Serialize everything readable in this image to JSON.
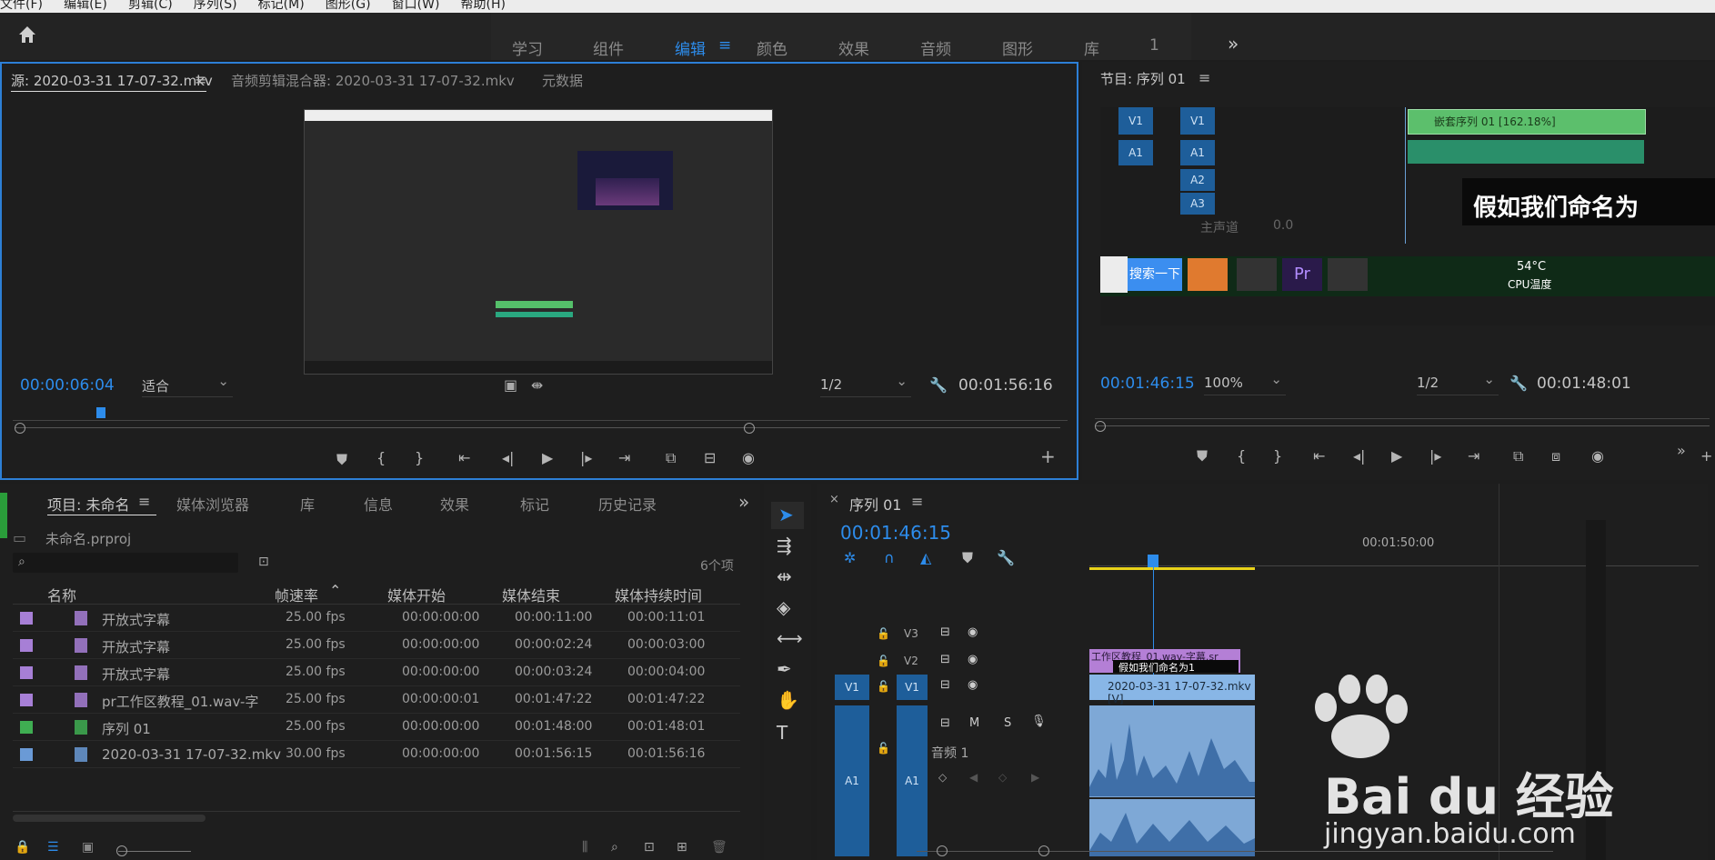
{
  "menu": [
    "文件(F)",
    "编辑(E)",
    "剪辑(C)",
    "序列(S)",
    "标记(M)",
    "图形(G)",
    "窗口(W)",
    "帮助(H)"
  ],
  "workspaces": [
    {
      "label": "学习",
      "active": false
    },
    {
      "label": "组件",
      "active": false
    },
    {
      "label": "编辑",
      "active": true
    },
    {
      "label": "颜色",
      "active": false
    },
    {
      "label": "效果",
      "active": false
    },
    {
      "label": "音频",
      "active": false
    },
    {
      "label": "图形",
      "active": false
    },
    {
      "label": "库",
      "active": false
    },
    {
      "label": "1",
      "active": false
    }
  ],
  "more": "»",
  "source": {
    "tabs": [
      "源: 2020-03-31 17-07-32.mkv",
      "音频剪辑混合器: 2020-03-31 17-07-32.mkv",
      "元数据"
    ],
    "timecode": "00:00:06:04",
    "fit": "适合",
    "res": "1/2",
    "duration": "00:01:56:16"
  },
  "program": {
    "tab": "节目: 序列 01",
    "timecode": "00:01:46:15",
    "zoom": "100%",
    "res": "1/2",
    "duration": "00:01:48:01",
    "overlay_text": "假如我们命名为",
    "nested_clip": "嵌套序列 01 [162.18%]",
    "tracks": [
      "V1",
      "A1",
      "A2",
      "A3"
    ],
    "master": "主声道",
    "master_val": "0.0",
    "taskbar_search": "搜索一下",
    "temp": "54°C",
    "cpu": "CPU温度"
  },
  "project": {
    "tabs": [
      "项目: 未命名",
      "媒体浏览器",
      "库",
      "信息",
      "效果",
      "标记",
      "历史记录"
    ],
    "file": "未命名.prproj",
    "count": "6个项",
    "columns": [
      "名称",
      "帧速率",
      "媒体开始",
      "媒体结束",
      "媒体持续时间"
    ],
    "rows": [
      {
        "name": "开放式字幕",
        "fps": "25.00 fps",
        "start": "00:00:00:00",
        "end": "00:00:11:00",
        "dur": "00:00:11:01",
        "color": "#a77fd6"
      },
      {
        "name": "开放式字幕",
        "fps": "25.00 fps",
        "start": "00:00:00:00",
        "end": "00:00:02:24",
        "dur": "00:00:03:00",
        "color": "#a77fd6"
      },
      {
        "name": "开放式字幕",
        "fps": "25.00 fps",
        "start": "00:00:00:00",
        "end": "00:00:03:24",
        "dur": "00:00:04:00",
        "color": "#a77fd6"
      },
      {
        "name": "pr工作区教程_01.wav-字",
        "fps": "25.00 fps",
        "start": "00:00:00:01",
        "end": "00:01:47:22",
        "dur": "00:01:47:22",
        "color": "#a77fd6"
      },
      {
        "name": "序列 01",
        "fps": "25.00 fps",
        "start": "00:00:00:00",
        "end": "00:01:48:00",
        "dur": "00:01:48:01",
        "color": "#3fae52"
      },
      {
        "name": "2020-03-31 17-07-32.mkv",
        "fps": "30.00 fps",
        "start": "00:00:00:00",
        "end": "00:01:56:15",
        "dur": "00:01:56:16",
        "color": "#6a9ad6"
      }
    ]
  },
  "timeline": {
    "tab": "序列 01",
    "timecode": "00:01:46:15",
    "ruler": "00:01:50:00",
    "tracks": [
      "V3",
      "V2",
      "V1",
      "A1"
    ],
    "clip_caption": "工作区教程_01.wav-字幕.sr",
    "clip_caption2": "假如我们命名为1",
    "clip_video": "2020-03-31 17-07-32.mkv [V]",
    "audio_label": "音频 1",
    "mute": "M",
    "solo": "S"
  },
  "watermark": {
    "brand": "Bai du 经验",
    "url": "jingyan.baidu.com"
  }
}
